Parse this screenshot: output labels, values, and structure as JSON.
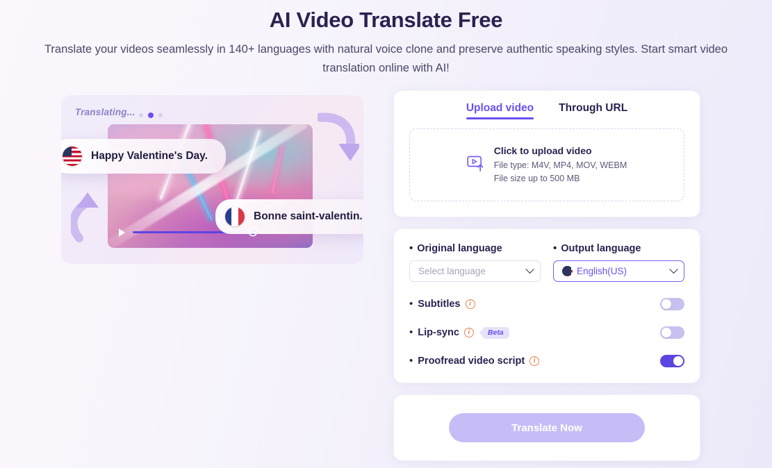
{
  "hero": {
    "title": "AI Video Translate Free",
    "subtitle": "Translate your videos seamlessly in 140+ languages with natural voice clone and preserve authentic speaking styles. Start smart video translation online with AI!"
  },
  "illustration": {
    "status_label": "Translating...",
    "source_caption": "Happy Valentine's Day.",
    "source_flag": "us-flag-icon",
    "target_caption": "Bonne saint-valentin.",
    "target_flag": "fr-flag-icon",
    "play_icon": "play-icon",
    "arrow_down_icon": "curved-arrow-down-icon",
    "arrow_up_icon": "curved-arrow-up-icon"
  },
  "upload": {
    "tabs": [
      {
        "label": "Upload video",
        "active": true
      },
      {
        "label": "Through URL",
        "active": false
      }
    ],
    "dropzone": {
      "icon": "video-upload-icon",
      "title": "Click to upload video",
      "file_type": "File type: M4V, MP4, MOV, WEBM",
      "file_size": "File size up to 500 MB"
    }
  },
  "settings": {
    "original_language": {
      "label": "Original language",
      "value": "",
      "placeholder": "Select language",
      "chevron": "chevron-down-icon"
    },
    "output_language": {
      "label": "Output language",
      "value": "English(US)",
      "flag": "us-flag-icon",
      "chevron": "chevron-down-icon"
    },
    "options": [
      {
        "label": "Subtitles",
        "info": "info-icon",
        "badge": null,
        "enabled": false
      },
      {
        "label": "Lip-sync",
        "info": "info-icon",
        "badge": "Beta",
        "enabled": false
      },
      {
        "label": "Proofread video script",
        "info": "info-icon",
        "badge": null,
        "enabled": true
      }
    ]
  },
  "cta": {
    "label": "Translate Now",
    "disabled": true
  },
  "colors": {
    "accent": "#6c4ff0",
    "toggle_on": "#5b46e3",
    "toggle_off": "#c6c1f0",
    "title": "#2b2250",
    "info_icon": "#e8834f",
    "cta_disabled": "#c7bdf6"
  }
}
